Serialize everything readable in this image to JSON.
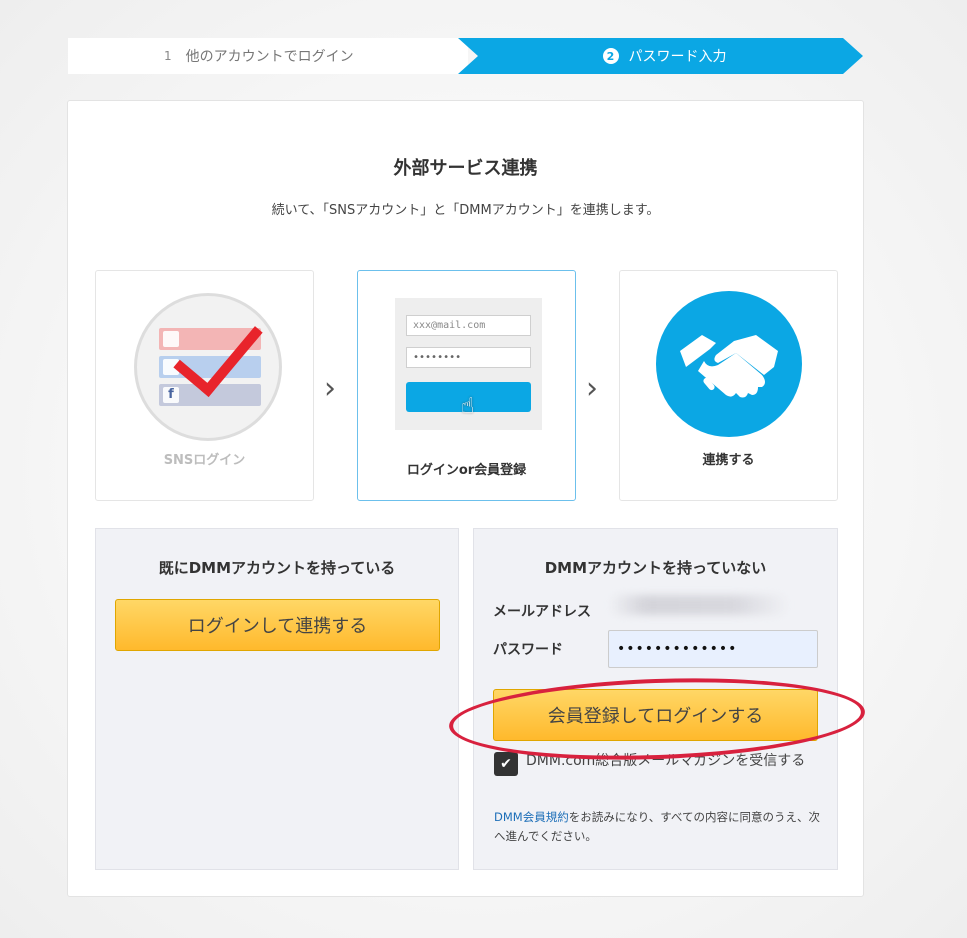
{
  "stepper": {
    "step1_num": "1",
    "step1_label": "他のアカウントでログイン",
    "step2_num": "2",
    "step2_label": "パスワード入力"
  },
  "header": {
    "title": "外部サービス連携",
    "subtitle": "続いて、「SNSアカウント」と「DMMアカウント」を連携します。"
  },
  "flow": {
    "step_sns": "SNSログイン",
    "step_login": "ログインor会員登録",
    "step_link": "連携する",
    "form_email_placeholder": "xxx@mail.com",
    "form_password_mask": "••••••••",
    "arrow": "›"
  },
  "existing": {
    "title": "既にDMMアカウントを持っている",
    "button": "ログインして連携する"
  },
  "register": {
    "title": "DMMアカウントを持っていない",
    "email_label": "メールアドレス",
    "password_label": "パスワード",
    "password_value": "•••••••••••••",
    "button": "会員登録してログインする",
    "newsletter_label": "DMM.com総合版メールマガジンを受信する",
    "newsletter_checked": true,
    "terms_link": "DMM会員規約",
    "terms_text": "をお読みになり、すべての内容に同意のうえ、次へ進んでください。"
  },
  "colors": {
    "accent": "#0ba7e4",
    "button_yellow": "#ffc640",
    "annotation_red": "#d8213e"
  }
}
